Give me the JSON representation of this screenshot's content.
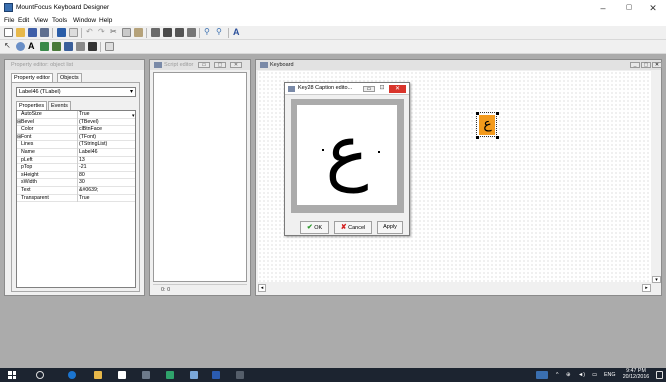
{
  "window": {
    "title": "MountFocus Keyboard Designer"
  },
  "menu": [
    "File",
    "Edit",
    "View",
    "Tools",
    "Window",
    "Help"
  ],
  "property_editor": {
    "title": "Property editor: object list",
    "tabs": [
      "Property editor",
      "Objects"
    ],
    "object_selector": "Label46 (TLabel)",
    "subtabs": [
      "Properties",
      "Events"
    ],
    "properties": [
      {
        "name": "AutoSize",
        "value": "True",
        "group": false
      },
      {
        "name": "Bevel",
        "value": "(TBevel)",
        "group": true
      },
      {
        "name": "Color",
        "value": "clBtnFace",
        "group": false
      },
      {
        "name": "Font",
        "value": "(TFont)",
        "group": true
      },
      {
        "name": "Lines",
        "value": "(TStringList)",
        "group": false
      },
      {
        "name": "Name",
        "value": "Label46",
        "group": false
      },
      {
        "name": "pLeft",
        "value": "13",
        "group": false
      },
      {
        "name": "pTop",
        "value": "-21",
        "group": false
      },
      {
        "name": "sHeight",
        "value": "80",
        "group": false
      },
      {
        "name": "sWidth",
        "value": "30",
        "group": false
      },
      {
        "name": "Text",
        "value": "&#0639;",
        "group": false
      },
      {
        "name": "Transparent",
        "value": "True",
        "group": false
      }
    ]
  },
  "script_editor": {
    "title": "Script editor",
    "status": "0: 0"
  },
  "keyboard": {
    "title": "Keyboard",
    "key_char": "ع"
  },
  "caption_dialog": {
    "title": "Key28 Caption edito...",
    "glyph": "ع",
    "ok_label": "OK",
    "cancel_label": "Cancel",
    "apply_label": "Apply"
  },
  "taskbar": {
    "time": "9:47 PM",
    "date": "20/12/2016",
    "lang": "ENG"
  },
  "colors": {
    "key_orange": "#f39a1c",
    "taskbar": "#1c2430",
    "workspace": "#ababab"
  }
}
